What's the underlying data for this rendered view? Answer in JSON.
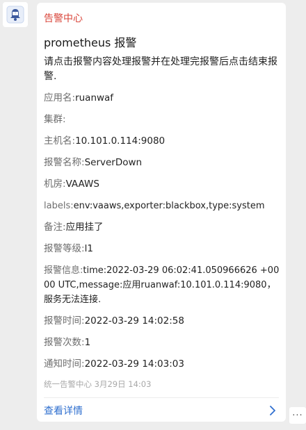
{
  "message": {
    "source": "告警中心",
    "title": "prometheus 报警",
    "intro": "请点击报警内容处理报警并在处理完报警后点击结束报警.",
    "fields": [
      {
        "key": "应用名:",
        "value": "ruanwaf"
      },
      {
        "key": "集群:",
        "value": ""
      },
      {
        "key": "主机名:",
        "value": "10.101.0.114:9080"
      },
      {
        "key": "报警名称:",
        "value": "ServerDown"
      },
      {
        "key": "机房:",
        "value": "VAAWS"
      },
      {
        "key": "labels:",
        "value": "env:vaaws,exporter:blackbox,type:system"
      },
      {
        "key": "备注:",
        "value": "应用挂了"
      },
      {
        "key": "报警等级:",
        "value": "l1"
      },
      {
        "key": "报警信息:",
        "value": "time:2022-03-29 06:02:41.050966626 +0000 UTC,message:应用ruanwaf:10.101.0.114:9080，服务无法连接."
      },
      {
        "key": "报警时间:",
        "value": "2022-03-29 14:02:58"
      },
      {
        "key": "报警次数:",
        "value": "1"
      },
      {
        "key": "通知时间:",
        "value": "2022-03-29 14:03:03"
      }
    ],
    "footer_meta": "统一告警中心 3月29日 14:03",
    "detail_link": "查看详情",
    "more_label": "···"
  },
  "colors": {
    "source": "#d9453a",
    "link": "#2f6fcf",
    "background": "#ededed"
  },
  "icons": {
    "avatar": "bell-badge-icon",
    "detail_chevron": "chevron-right-icon"
  }
}
